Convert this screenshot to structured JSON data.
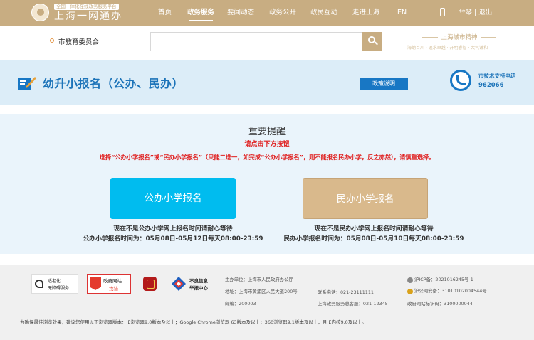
{
  "header": {
    "logo_tagline": "全国一体化在线政务服务平台",
    "logo_title": "上海一网通办",
    "nav": [
      "首页",
      "政务服务",
      "要闻动态",
      "政务公开",
      "政民互动",
      "走进上海",
      "EN"
    ],
    "active_nav": "政务服务",
    "user_text": "**琴 | 退出"
  },
  "search_strip": {
    "department": "市教育委员会",
    "search_placeholder": "",
    "slogan_title": "上海城市精神",
    "slogan_sub": "海纳百川 · 追求卓越 · 开明睿智 · 大气谦和"
  },
  "banner": {
    "title": "幼升小报名（公办、民办）",
    "policy_button": "政策说明",
    "support_label": "市技术支持电话",
    "support_phone": "962066"
  },
  "main": {
    "notice_title": "重要提醒",
    "notice_sub": "请点击下方按钮",
    "notice_body": "选择“公办小学报名”或“民办小学报名”（只能二选一，如完成“公办小学报名”，则不能报名民办小学，反之亦然），请慎重选择。",
    "public_button": "公办小学报名",
    "private_button": "民办小学报名",
    "public_status": "现在不是公办小学网上报名时间请耐心等待",
    "public_time": "公办小学报名时间为：05月08日-05月12日每天08:00-23:59",
    "private_status": "现在不是民办小学网上报名时间请耐心等待",
    "private_time": "民办小学报名时间为：05月08日-05月10日每天08:00-23:59"
  },
  "footer": {
    "aging_line1": "适老化",
    "aging_line2": "无障碍服务",
    "gov_site_line1": "政府网站",
    "gov_site_line2": "找错",
    "report_line1": "不良信息",
    "report_line2": "举报中心",
    "sponsor": "主办单位：上海市人民政府办公厅",
    "address": "地址：上海市黄浦区人民大道200号",
    "postcode": "邮编：200003",
    "contact_phone": "联系电话：021-23111111",
    "service_phone": "上海政务服务总客服：021-12345",
    "icp": "沪ICP备：2021016245号-1",
    "police": "沪公网安备：31010102004544号",
    "site_code": "政府网站标识码：3100000044",
    "browser_note": "为确保最佳浏览效果，建议您使用以下浏览器版本：IE浏览器9.0版本及以上；Google Chrome浏览器 63版本及以上；360浏览器9.1版本及以上，且IE内核9.0及以上。"
  },
  "colors": {
    "header_gold": "#c8ad82",
    "accent_blue": "#1877c4",
    "public_button": "#00bcef",
    "private_button": "#d9b98c",
    "warning_red": "#e02020"
  }
}
